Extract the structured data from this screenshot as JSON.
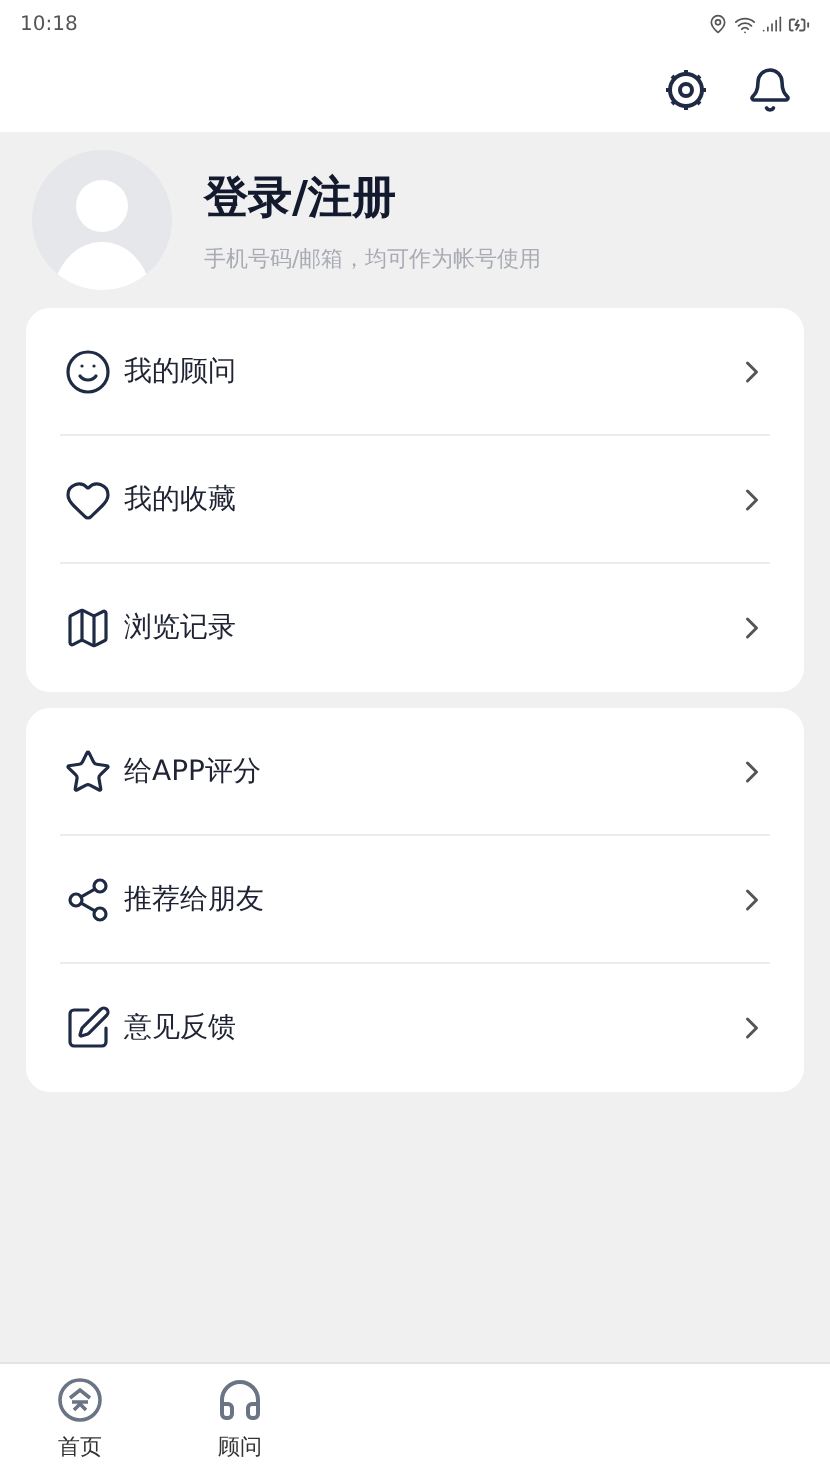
{
  "status_bar": {
    "time": "10:18"
  },
  "profile": {
    "title": "登录/注册",
    "subtitle": "手机号码/邮箱，均可作为帐号使用"
  },
  "menu_groups": [
    {
      "items": [
        {
          "label": "我的顾问"
        },
        {
          "label": "我的收藏"
        },
        {
          "label": "浏览记录"
        }
      ]
    },
    {
      "items": [
        {
          "label": "给APP评分"
        },
        {
          "label": "推荐给朋友"
        },
        {
          "label": "意见反馈"
        }
      ]
    }
  ],
  "bottom_nav": [
    {
      "label": "首页"
    },
    {
      "label": "顾问"
    }
  ]
}
